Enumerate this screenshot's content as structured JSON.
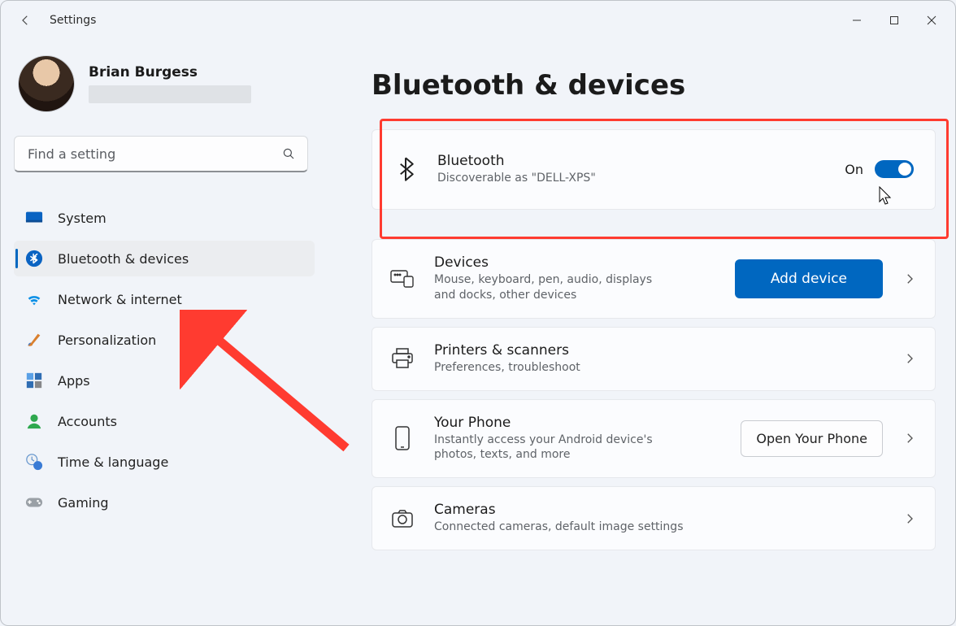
{
  "window": {
    "title": "Settings"
  },
  "profile": {
    "name": "Brian Burgess"
  },
  "search": {
    "placeholder": "Find a setting"
  },
  "nav": {
    "items": [
      {
        "key": "system",
        "label": "System"
      },
      {
        "key": "bluetooth",
        "label": "Bluetooth & devices",
        "active": true
      },
      {
        "key": "network",
        "label": "Network & internet"
      },
      {
        "key": "personal",
        "label": "Personalization"
      },
      {
        "key": "apps",
        "label": "Apps"
      },
      {
        "key": "accounts",
        "label": "Accounts"
      },
      {
        "key": "time",
        "label": "Time & language"
      },
      {
        "key": "gaming",
        "label": "Gaming"
      }
    ]
  },
  "page": {
    "title": "Bluetooth & devices"
  },
  "bluetooth_card": {
    "title": "Bluetooth",
    "sub": "Discoverable as \"DELL-XPS\"",
    "state_label": "On"
  },
  "devices_card": {
    "title": "Devices",
    "sub": "Mouse, keyboard, pen, audio, displays and docks, other devices",
    "button": "Add device"
  },
  "printers_card": {
    "title": "Printers & scanners",
    "sub": "Preferences, troubleshoot"
  },
  "phone_card": {
    "title": "Your Phone",
    "sub": "Instantly access your Android device's photos, texts, and more",
    "button": "Open Your Phone"
  },
  "cameras_card": {
    "title": "Cameras",
    "sub": "Connected cameras, default image settings"
  },
  "colors": {
    "accent": "#0067c0",
    "highlight": "#ff3b30"
  }
}
